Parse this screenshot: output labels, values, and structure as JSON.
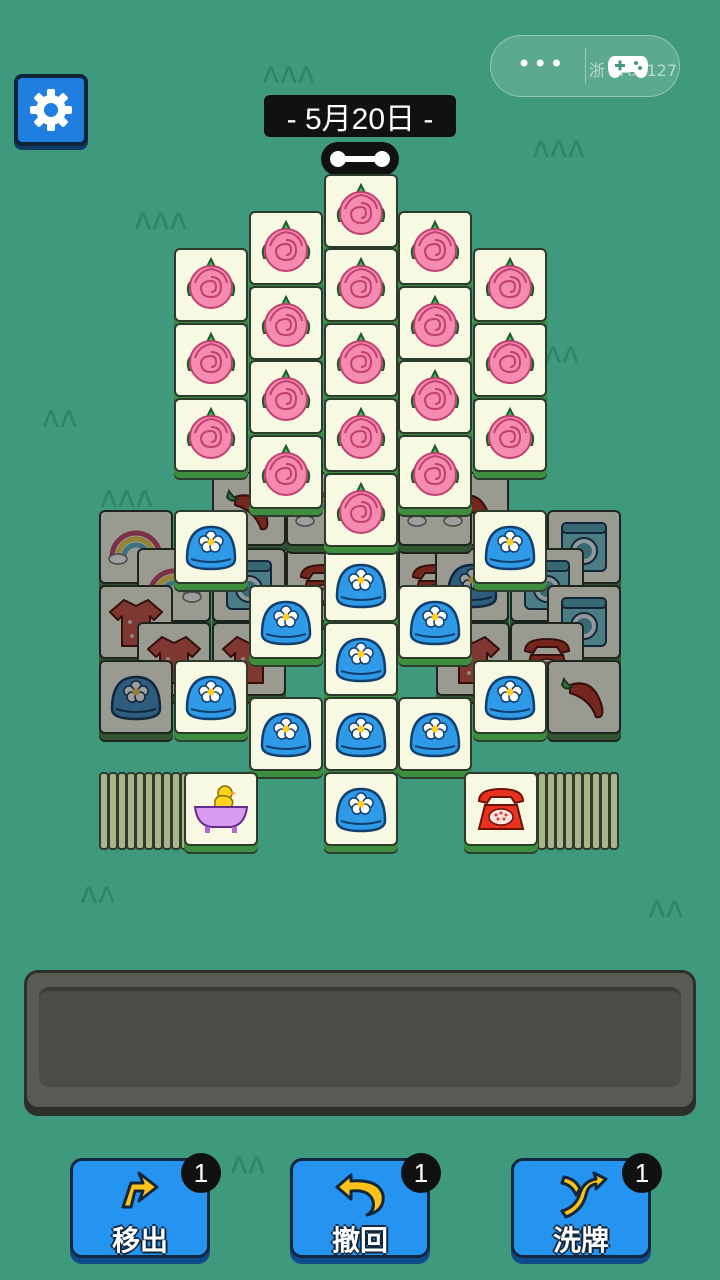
{
  "header": {
    "date_label": "- 5月20日 -",
    "settings_icon": "gear-icon"
  },
  "capsule": {
    "menu_dots": "•••",
    "license_text": "浙      4A:1127",
    "icon": "gamepad-icon"
  },
  "tools": [
    {
      "id": "move-out",
      "label": "移出",
      "badge": "1",
      "icon": "move-out-icon"
    },
    {
      "id": "undo",
      "label": "撤回",
      "badge": "1",
      "icon": "undo-arrow-icon"
    },
    {
      "id": "shuffle",
      "label": "洗牌",
      "badge": "1",
      "icon": "shuffle-icon"
    }
  ],
  "colors": {
    "background": "#3f9a7d",
    "tile_face": "#f7f9e2",
    "button_blue": "#2593f0",
    "tray": "#5a5a55"
  },
  "board": {
    "tile_types": [
      "rose",
      "blue-bun",
      "rubber-duck-bathtub",
      "red-telephone",
      "rainbow",
      "washing-machine",
      "red-shirt",
      "chili-pepper"
    ]
  }
}
